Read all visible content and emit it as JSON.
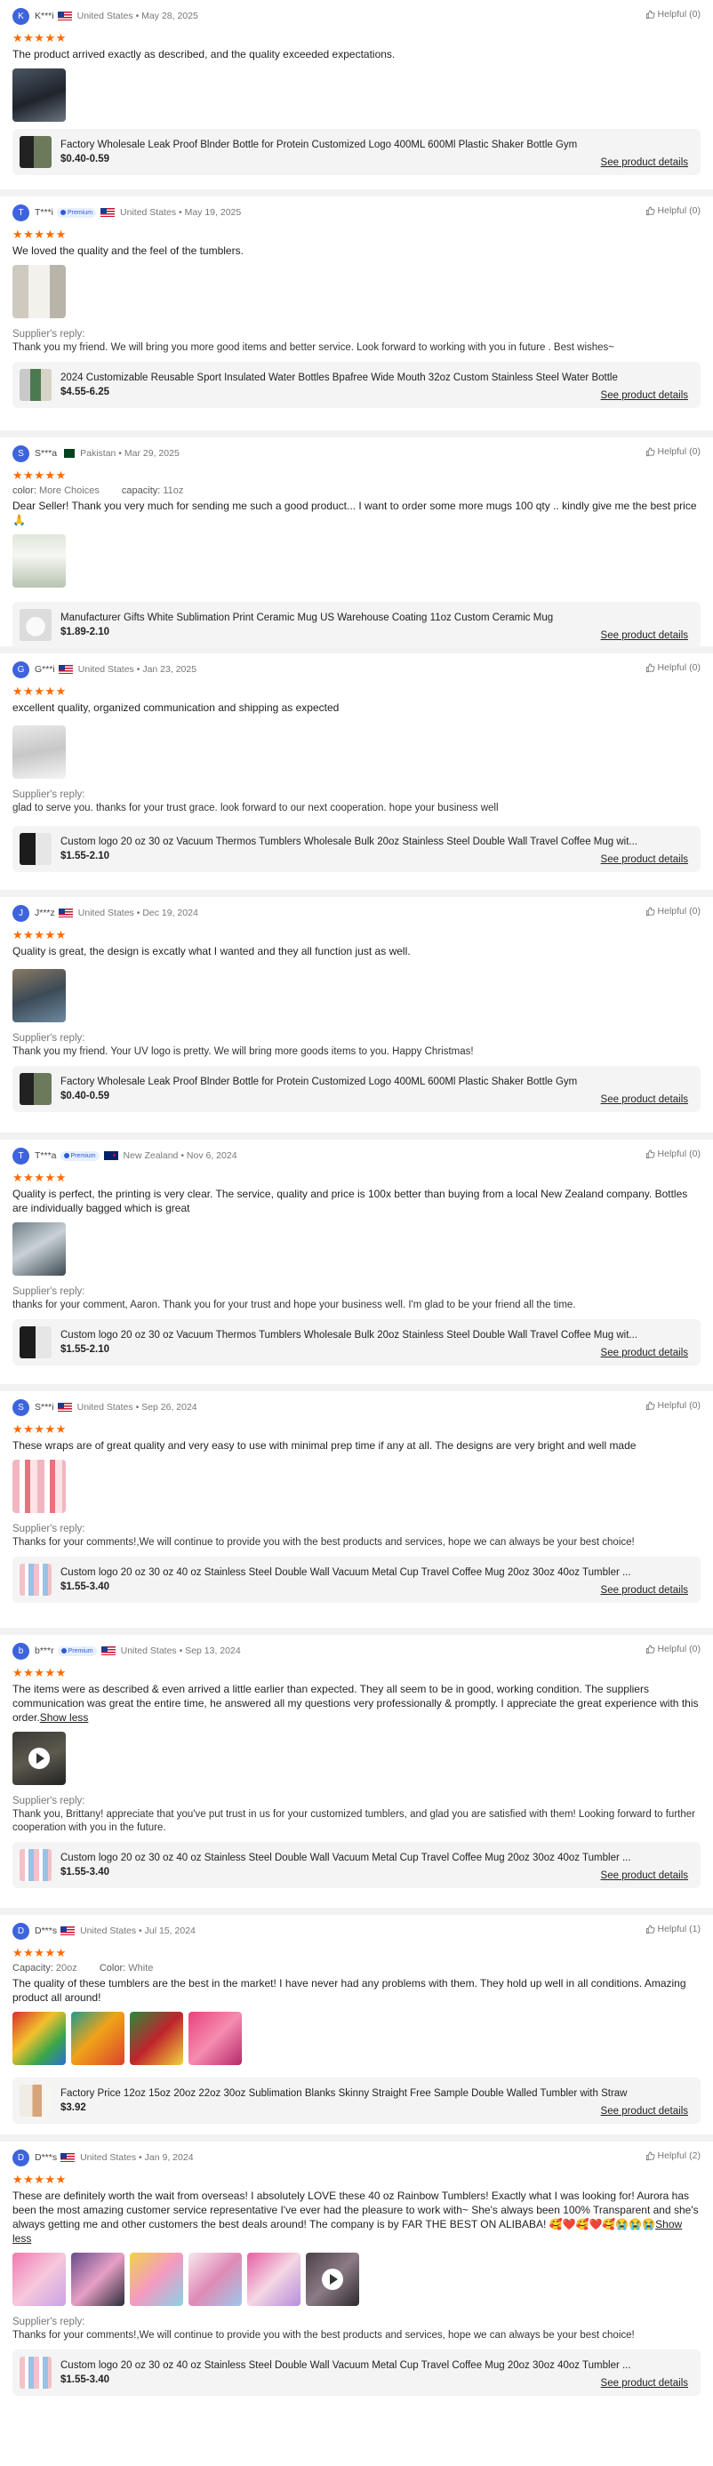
{
  "helpful_label": "Helpful",
  "reply_label": "Supplier's reply:",
  "details_label": "See product details",
  "show_less": "Show less",
  "reviews": [
    {
      "initial": "K",
      "user": "K***i",
      "country": "United States",
      "date": "May 28, 2025",
      "helpful": "(0)",
      "text": "The product arrived exactly as described, and the quality exceeded expectations.",
      "product_title": "Factory Wholesale Leak Proof Blnder Bottle for Protein Customized Logo 400ML 600Ml Plastic Shaker Bottle Gym",
      "price": "$0.40-0.59"
    },
    {
      "initial": "T",
      "user": "T***i",
      "badge": "Premium",
      "country": "United States",
      "date": "May 19, 2025",
      "helpful": "(0)",
      "text": "We loved the quality and the feel of the tumblers.",
      "reply": "Thank you my friend. We will bring you more good items and better service. Look forward to working with you in future . Best wishes~",
      "product_title": "2024 Customizable Reusable Sport Insulated Water Bottles Bpafree Wide Mouth 32oz Custom Stainless Steel Water Bottle",
      "price": "$4.55-6.25"
    },
    {
      "initial": "S",
      "user": "S***a",
      "country": "Pakistan",
      "date": "Mar 29, 2025",
      "helpful": "(0)",
      "attr1_name": "color:",
      "attr1_value": "More Choices",
      "attr2_name": "capacity:",
      "attr2_value": "11oz",
      "text": "Dear Seller! Thank you very much for sending me such a good product... I want to order some more mugs 100 qty .. kindly give me the best price 🙏",
      "product_title": "Manufacturer Gifts White Sublimation Print Ceramic Mug US Warehouse Coating 11oz Custom Ceramic Mug",
      "price": "$1.89-2.10"
    },
    {
      "initial": "G",
      "user": "G***i",
      "country": "United States",
      "date": "Jan 23, 2025",
      "helpful": "(0)",
      "text": "excellent quality, organized communication and shipping as expected",
      "reply": "glad to serve you. thanks for your trust grace. look forward to our next cooperation. hope your business well",
      "product_title": "Custom logo 20 oz 30 oz Vacuum Thermos Tumblers Wholesale Bulk 20oz Stainless Steel Double Wall Travel Coffee Mug wit...",
      "price": "$1.55-2.10"
    },
    {
      "initial": "J",
      "user": "J***z",
      "country": "United States",
      "date": "Dec 19, 2024",
      "helpful": "(0)",
      "text": "Quality is great, the design is excatly what I wanted and they all function just as well.",
      "reply": "Thank you my friend. Your UV logo is pretty. We will bring more goods items to you. Happy Christmas!",
      "product_title": "Factory Wholesale Leak Proof Blnder Bottle for Protein Customized Logo 400ML 600Ml Plastic Shaker Bottle Gym",
      "price": "$0.40-0.59"
    },
    {
      "initial": "T",
      "user": "T***a",
      "badge": "Premium",
      "country": "New Zealand",
      "date": "Nov 6, 2024",
      "helpful": "(0)",
      "text": "Quality is perfect, the printing is very clear. The service, quality and price is 100x better than buying from a local New Zealand company. Bottles are individually bagged which is great",
      "reply": "thanks for your comment, Aaron. Thank you for your trust and hope your business well. I'm glad to be your friend all the time.",
      "product_title": "Custom logo 20 oz 30 oz Vacuum Thermos Tumblers Wholesale Bulk 20oz Stainless Steel Double Wall Travel Coffee Mug wit...",
      "price": "$1.55-2.10"
    },
    {
      "initial": "S",
      "user": "S***i",
      "country": "United States",
      "date": "Sep 26, 2024",
      "helpful": "(0)",
      "text": "These wraps are of great quality and very easy to use with minimal prep time if any at all. The designs are very bright and well made",
      "reply": "Thanks for your comments!,We will continue to provide you with the best products and services, hope we can always be your best choice!",
      "product_title": "Custom logo 20 oz 30 oz 40 oz Stainless Steel Double Wall Vacuum Metal Cup Travel Coffee Mug 20oz 30oz 40oz Tumbler ...",
      "price": "$1.55-3.40"
    },
    {
      "initial": "b",
      "user": "b***r",
      "badge": "Premium",
      "country": "United States",
      "date": "Sep 13, 2024",
      "helpful": "(0)",
      "text": "The items were as described & even arrived a little earlier than expected. They all seem to be in good, working condition. The suppliers communication was great the entire time, he answered all my questions very professionally & promptly. I appreciate the great experience with this order.",
      "reply": "Thank you, Brittany! appreciate that you've put trust in us for your customized tumblers, and glad you are satisfied with them! Looking forward to further cooperation with you in the future.",
      "product_title": "Custom logo 20 oz 30 oz 40 oz Stainless Steel Double Wall Vacuum Metal Cup Travel Coffee Mug 20oz 30oz 40oz Tumbler ...",
      "price": "$1.55-3.40"
    },
    {
      "initial": "D",
      "user": "D***s",
      "country": "United States",
      "date": "Jul 15, 2024",
      "helpful": "(1)",
      "attr1_name": "Capacity:",
      "attr1_value": "20oz",
      "attr2_name": "Color:",
      "attr2_value": "White",
      "text": "The quality of these tumblers are the best in the market! I have never had any problems with them. They hold up well in all conditions. Amazing product all around!",
      "product_title": "Factory Price 12oz 15oz 20oz 22oz 30oz Sublimation Blanks Skinny Straight Free Sample Double Walled Tumbler with Straw",
      "price": "$3.92"
    },
    {
      "initial": "D",
      "user": "D***s",
      "country": "United States",
      "date": "Jan 9, 2024",
      "helpful": "(2)",
      "text": "These are definitely worth the wait from overseas! I absolutely LOVE these 40 oz Rainbow Tumblers! Exactly what I was looking for! Aurora has been the most amazing customer service representative I've ever had the pleasure to work with~ She's always been 100% Transparent and she's always getting me and other customers the best deals around! The company is by FAR THE BEST ON ALIBABA! 🥰❤️🥰❤️🥰😭😭😭",
      "reply": "Thanks for your comments!,We will continue to provide you with the best products and services, hope we can always be your best choice!",
      "product_title": "Custom logo 20 oz 30 oz 40 oz Stainless Steel Double Wall Vacuum Metal Cup Travel Coffee Mug 20oz 30oz 40oz Tumbler ...",
      "price": "$1.55-3.40"
    }
  ]
}
